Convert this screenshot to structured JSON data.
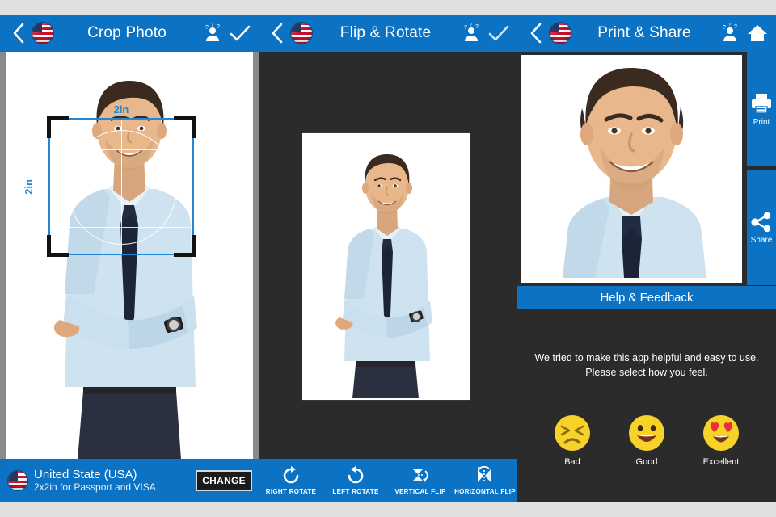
{
  "app": {
    "accent_blue": "#0b72c4",
    "dark_bg": "#2b2b2b",
    "canvas_gray": "#8a8a8a",
    "crop_guide_blue": "#1f86d8"
  },
  "panels": {
    "crop": {
      "header": {
        "title": "Crop Photo",
        "back_icon": "chevron-left-icon",
        "flag_icon": "usa-flag-icon",
        "help_icon": "help-person-icon",
        "confirm_icon": "check-icon"
      },
      "crop_overlay": {
        "width_label": "2in",
        "height_label": "2in"
      },
      "country_bar": {
        "flag_icon": "usa-flag-icon",
        "country": "United State (USA)",
        "spec": "2x2in for Passport and VISA",
        "change_label": "CHANGE"
      }
    },
    "flip": {
      "header": {
        "title": "Flip & Rotate",
        "back_icon": "chevron-left-icon",
        "flag_icon": "usa-flag-icon",
        "help_icon": "help-person-icon",
        "confirm_icon": "check-icon"
      },
      "tools": [
        {
          "label": "RIGHT ROTATE",
          "icon": "rotate-right-icon"
        },
        {
          "label": "LEFT ROTATE",
          "icon": "rotate-left-icon"
        },
        {
          "label": "VERTICAL FLIP",
          "icon": "flip-vertical-icon"
        },
        {
          "label": "HORIZONTAL FLIP",
          "icon": "flip-horizontal-icon"
        }
      ]
    },
    "print": {
      "header": {
        "title": "Print & Share",
        "back_icon": "chevron-left-icon",
        "flag_icon": "usa-flag-icon",
        "help_icon": "help-person-icon",
        "home_icon": "home-icon"
      },
      "rail": [
        {
          "label": "Print",
          "icon": "printer-icon"
        },
        {
          "label": "Share",
          "icon": "share-icon"
        }
      ],
      "feedback": {
        "bar_title": "Help & Feedback",
        "prompt_line1": "We tried to make this app helpful and easy to use.",
        "prompt_line2": "Please select how you feel.",
        "ratings": [
          {
            "label": "Bad",
            "icon": "confounded-face-icon"
          },
          {
            "label": "Good",
            "icon": "grinning-face-icon"
          },
          {
            "label": "Excellent",
            "icon": "heart-eyes-face-icon"
          }
        ]
      }
    }
  }
}
